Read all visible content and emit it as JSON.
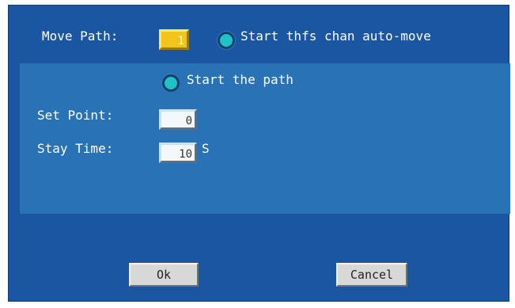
{
  "colors": {
    "dialog_bg": "#1a56a2",
    "panel_bg": "#2872b5",
    "radio": "#1fc2c6",
    "highlight_field": "#f3c51a"
  },
  "move_path": {
    "label": "Move Path:",
    "value": "1"
  },
  "auto_move": {
    "label": "Start thfs chan auto-move",
    "icon": "radio-icon"
  },
  "path": {
    "start_label": "Start the path",
    "icon": "radio-icon",
    "set_point": {
      "label": "Set Point:",
      "value": "0"
    },
    "stay_time": {
      "label": "Stay Time:",
      "value": "10",
      "unit": "S"
    }
  },
  "buttons": {
    "ok": "Ok",
    "cancel": "Cancel"
  }
}
